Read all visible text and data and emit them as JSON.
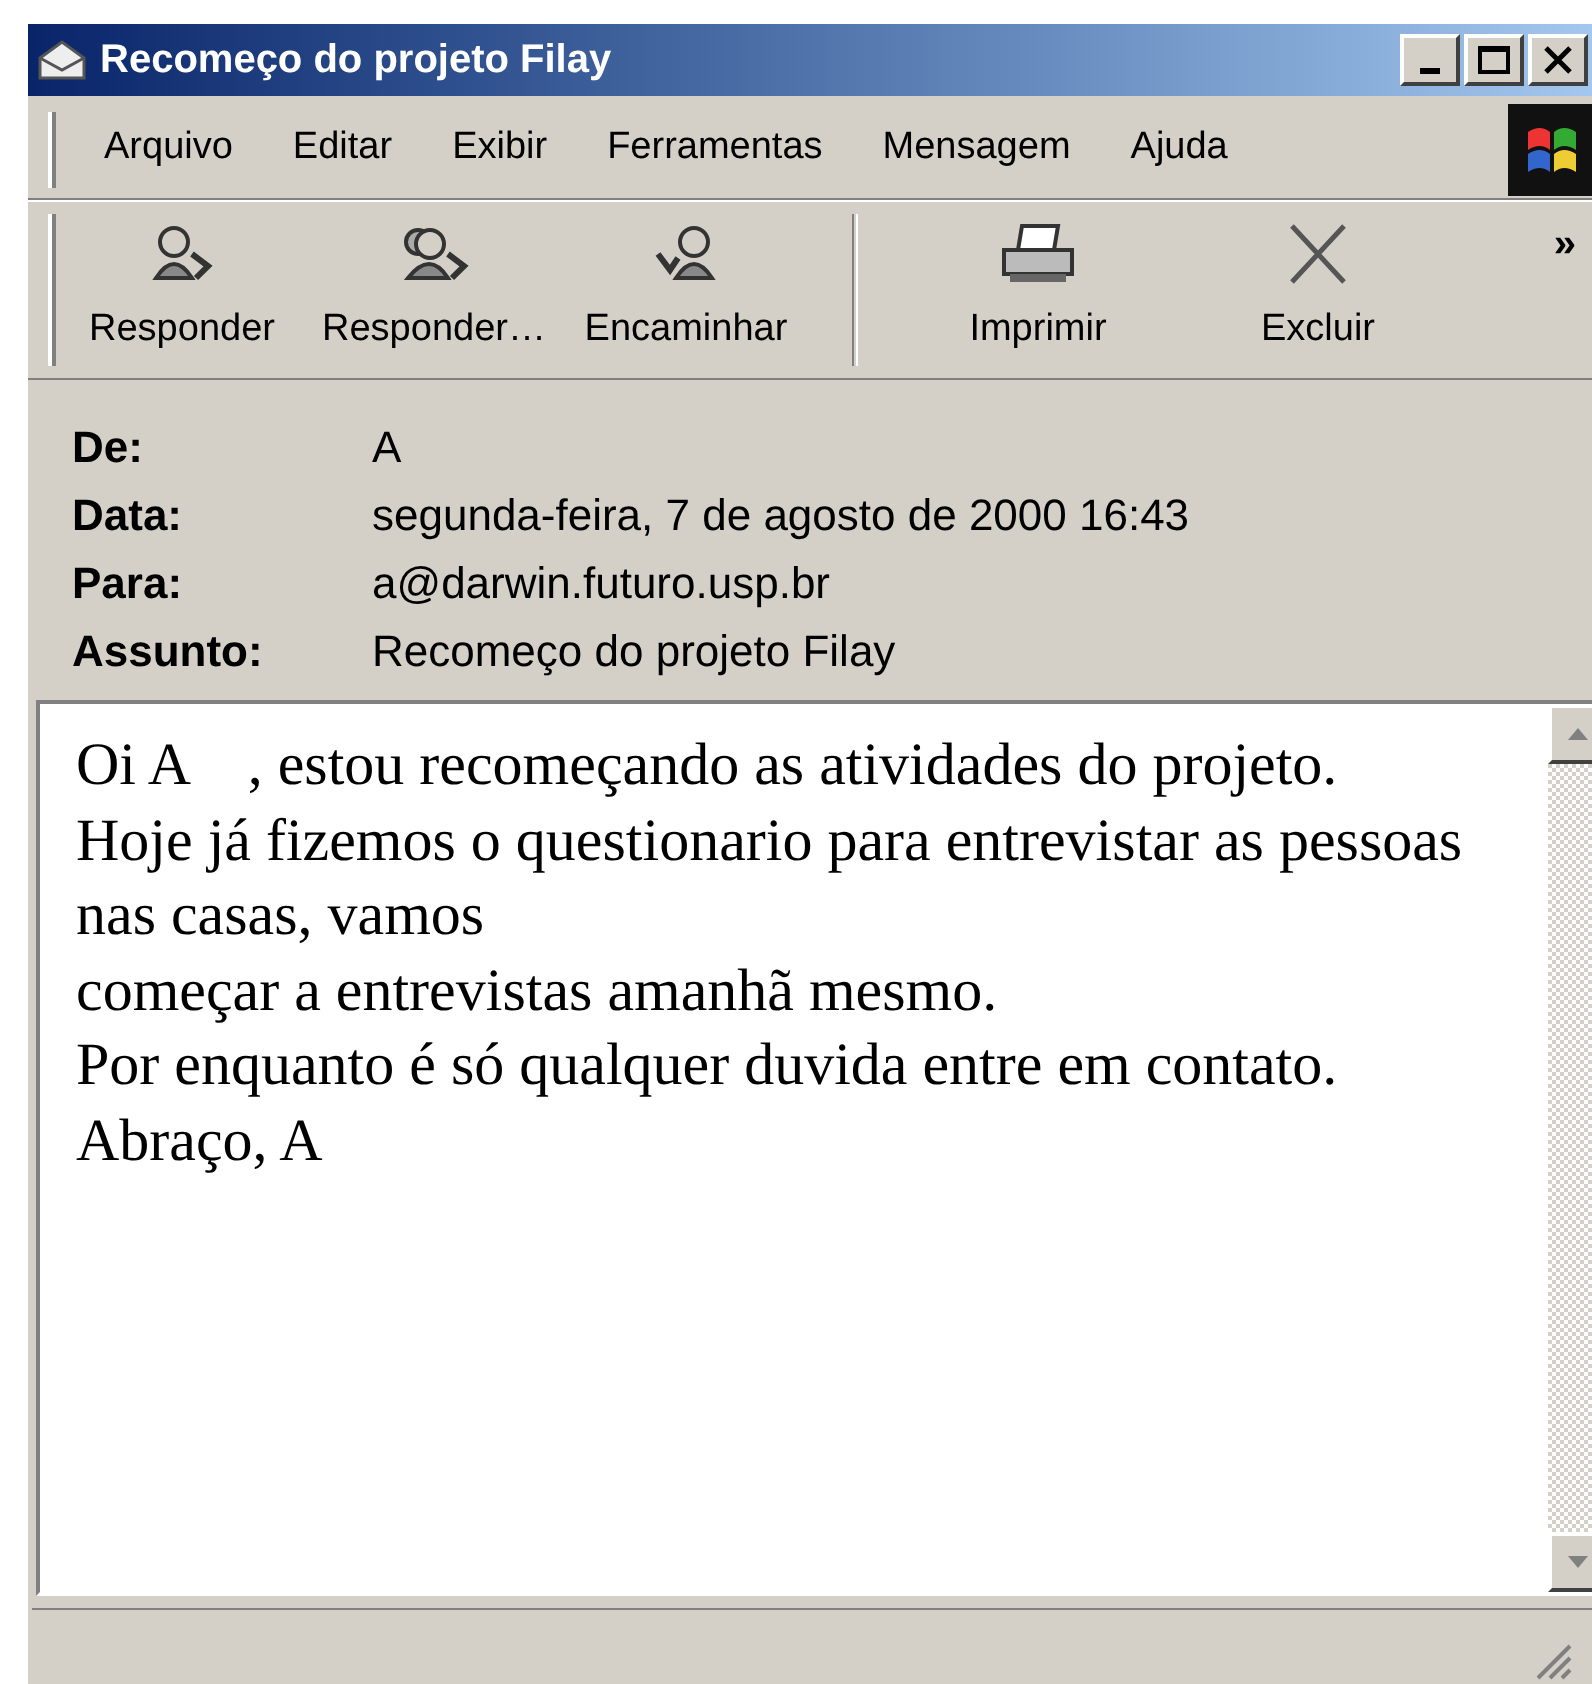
{
  "window": {
    "title": "Recomeço do projeto Filay"
  },
  "menu": [
    "Arquivo",
    "Editar",
    "Exibir",
    "Ferramentas",
    "Mensagem",
    "Ajuda"
  ],
  "toolbar": [
    {
      "kind": "reply",
      "label": "Responder"
    },
    {
      "kind": "reply-all",
      "label": "Responder…"
    },
    {
      "kind": "forward",
      "label": "Encaminhar"
    },
    {
      "kind": "print",
      "label": "Imprimir"
    },
    {
      "kind": "delete",
      "label": "Excluir"
    }
  ],
  "toolbar_more": "»",
  "header": [
    {
      "label": "De:",
      "value": "A"
    },
    {
      "label": "Data:",
      "value": "segunda-feira, 7 de agosto de 2000 16:43"
    },
    {
      "label": "Para:",
      "value": "a@darwin.futuro.usp.br"
    },
    {
      "label": "Assunto:",
      "value": "Recomeço do projeto Filay"
    }
  ],
  "body": [
    "Oi A    , estou recomeçando as atividades do projeto.",
    "Hoje já fizemos o questionario para entrevistar as pessoas nas casas, vamos",
    "começar a entrevistas amanhã mesmo.",
    "Por enquanto é só qualquer duvida entre em contato.",
    "Abraço, A"
  ]
}
